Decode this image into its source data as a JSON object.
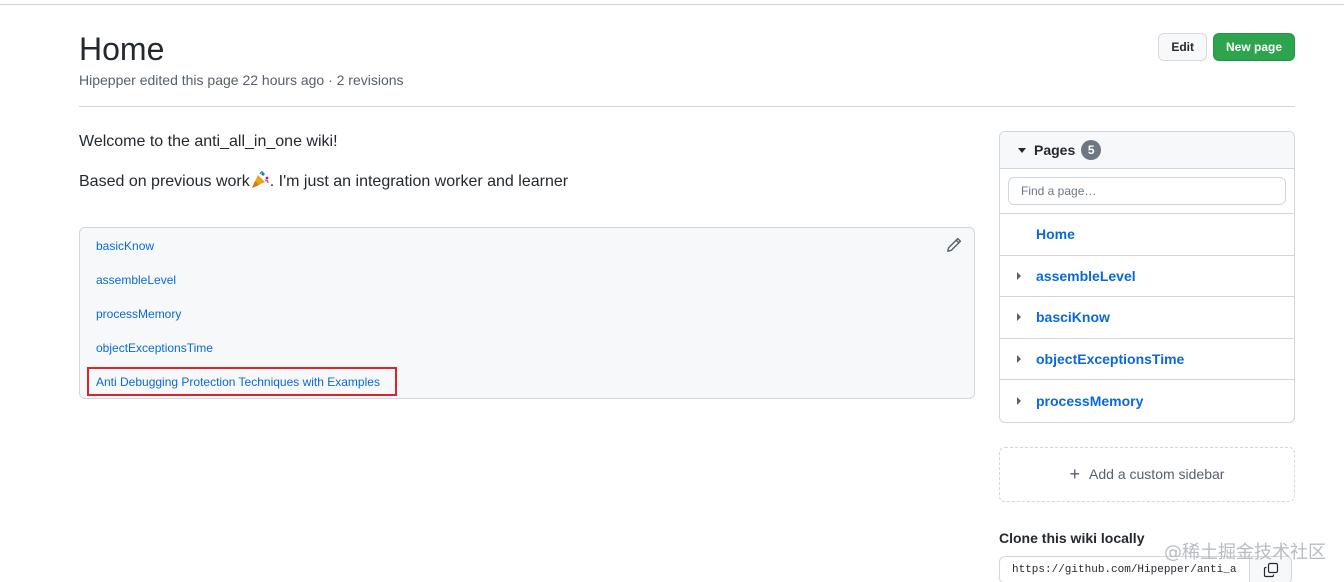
{
  "header": {
    "title": "Home",
    "author": "Hipepper",
    "meta_rest": "edited this page 22 hours ago · 2 revisions",
    "edit_label": "Edit",
    "new_page_label": "New page"
  },
  "body": {
    "welcome": "Welcome to the anti_all_in_one wiki!",
    "based_prefix": "Based on previous work",
    "based_suffix": ". I'm just an integration worker and learner"
  },
  "links": [
    {
      "label": "basicKnow"
    },
    {
      "label": "assembleLevel"
    },
    {
      "label": "processMemory"
    },
    {
      "label": "objectExceptionsTime"
    },
    {
      "label": "Anti Debugging Protection Techniques with Examples"
    }
  ],
  "sidebar": {
    "pages_label": "Pages",
    "pages_count": "5",
    "filter_placeholder": "Find a page…",
    "items": [
      {
        "label": "Home"
      },
      {
        "label": "assembleLevel"
      },
      {
        "label": "basciKnow"
      },
      {
        "label": "objectExceptionsTime"
      },
      {
        "label": "processMemory"
      }
    ],
    "custom_sidebar_label": "Add a custom sidebar",
    "clone_label": "Clone this wiki locally",
    "clone_url": "https://github.com/Hipepper/anti_a"
  },
  "watermark": "@稀土掘金技术社区",
  "colors": {
    "link": "#0969da",
    "primary_button": "#2da44e",
    "highlight_border": "#d9242e"
  },
  "icons": [
    "pencil-icon",
    "caret-down-icon",
    "caret-right-icon",
    "plus-icon",
    "copy-icon",
    "party-popper-icon"
  ]
}
